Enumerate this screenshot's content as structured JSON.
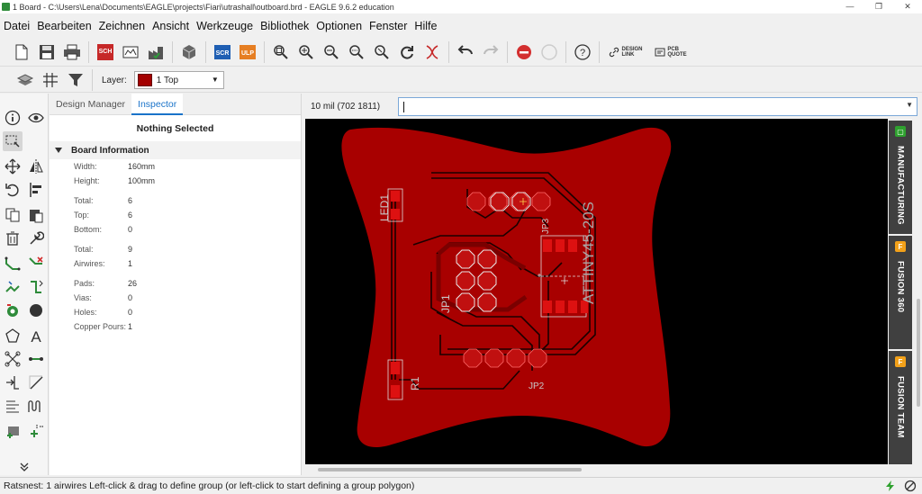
{
  "window": {
    "title": "1 Board - C:\\Users\\Lena\\Documents\\EAGLE\\projects\\Fiari\\utrashall\\outboard.brd - EAGLE 9.6.2 education",
    "minimize": "—",
    "maximize": "❐",
    "close": "✕"
  },
  "menu": [
    "Datei",
    "Bearbeiten",
    "Zeichnen",
    "Ansicht",
    "Werkzeuge",
    "Bibliothek",
    "Optionen",
    "Fenster",
    "Hilfe"
  ],
  "toolbar": {
    "sch_label": "SCH",
    "scr_label": "SCR",
    "ulp_label": "ULP",
    "design_link": [
      "DESIGN",
      "LINK"
    ],
    "pcb_quote": [
      "PCB",
      "QUOTE"
    ],
    "help": "?"
  },
  "layerbar": {
    "label": "Layer:",
    "selected": "1 Top",
    "swatch_color": "#a30000"
  },
  "panel": {
    "tabs": [
      "Design Manager",
      "Inspector"
    ],
    "active_tab": "Inspector",
    "nothing_selected": "Nothing Selected",
    "section_title": "Board Information",
    "rows": [
      {
        "key": "Width:",
        "value": "160mm"
      },
      {
        "key": "Height:",
        "value": "100mm"
      },
      {
        "key": "Total:",
        "value": "6"
      },
      {
        "key": "Top:",
        "value": "6"
      },
      {
        "key": "Bottom:",
        "value": "0"
      },
      {
        "key": "Total:",
        "value": "9"
      },
      {
        "key": "Airwires:",
        "value": "1"
      },
      {
        "key": "Pads:",
        "value": "26"
      },
      {
        "key": "Vias:",
        "value": "0"
      },
      {
        "key": "Holes:",
        "value": "0"
      },
      {
        "key": "Copper Pours:",
        "value": "1"
      }
    ]
  },
  "command": {
    "coordinate": "10 mil (702 1811)",
    "value": ""
  },
  "board_labels": {
    "led": "LED1",
    "ic": "ATTINY45-20S",
    "jp1": "JP1",
    "r1": "R1",
    "jp2": "JP2",
    "jp3": "JP3"
  },
  "sidetabs": [
    {
      "label": "MANUFACTURING",
      "icon_color": "#2fa12f"
    },
    {
      "label": "FUSION 360",
      "icon_color": "#f2a11a"
    },
    {
      "label": "FUSION TEAM",
      "icon_color": "#f2a11a"
    }
  ],
  "statusbar": {
    "text": "Ratsnest: 1 airwires Left-click & drag to define group (or left-click to start defining a group polygon)"
  }
}
